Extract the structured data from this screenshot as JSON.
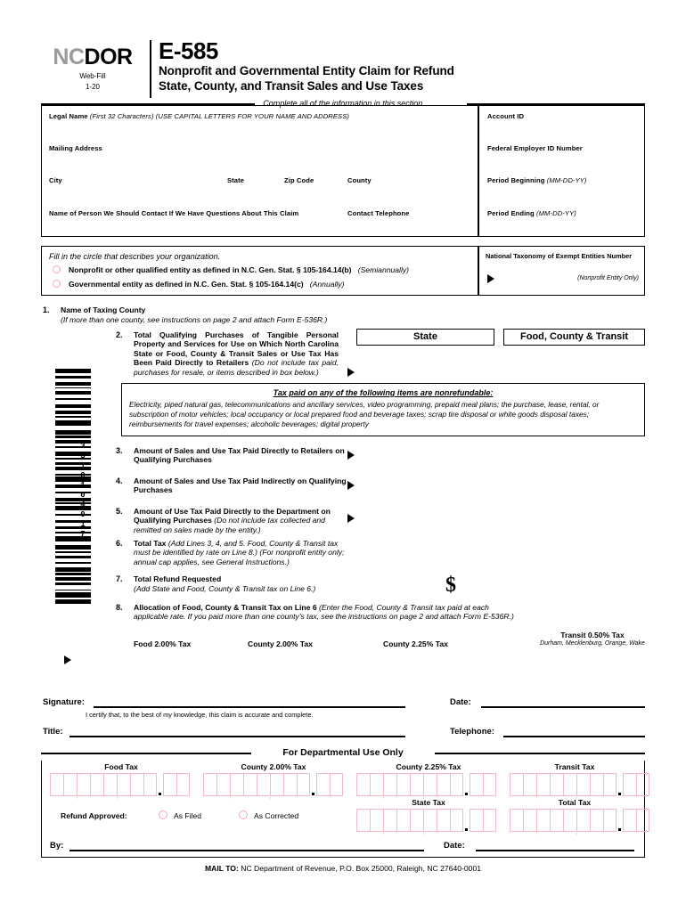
{
  "header": {
    "logo_nc": "NC",
    "logo_dor": "DOR",
    "webfill": "Web-Fill",
    "revision": "1-20",
    "form_number": "E-585",
    "title_line1": "Nonprofit and Governmental Entity Claim for Refund",
    "title_line2": "State, County, and Transit Sales and Use Taxes",
    "complete_note": "Complete all of the information in this section."
  },
  "identification": {
    "legal_name_label": "Legal Name",
    "legal_name_note": "(First 32 Characters) (USE CAPITAL LETTERS FOR YOUR NAME AND ADDRESS)",
    "mailing_address_label": "Mailing Address",
    "city_label": "City",
    "state_label": "State",
    "zip_label": "Zip Code",
    "county_label": "County",
    "contact_name_label": "Name of Person We Should Contact If We Have Questions About This Claim",
    "contact_phone_label": "Contact Telephone",
    "account_id_label": "Account ID",
    "fein_label": "Federal Employer  ID Number",
    "period_beginning_label": "Period Beginning",
    "period_beginning_format": "(MM-DD-YY)",
    "period_ending_label": "Period Ending",
    "period_ending_format": "(MM-DD-YY)"
  },
  "organization": {
    "instruction": "Fill in the circle that describes your organization.",
    "option1_text": "Nonprofit or other qualified entity as defined in N.C. Gen. Stat. § 105-164.14(b)",
    "option1_freq": "(Semiannually)",
    "option2_text": "Governmental entity as defined in N.C. Gen. Stat. § 105-164.14(c)",
    "option2_freq": "(Annually)",
    "ntee_label": "National Taxonomy of Exempt Entities Number",
    "ntee_note": "(Nonprofit Entity Only)"
  },
  "lines": {
    "l1_num": "1.",
    "l1_title": "Name of Taxing County",
    "l1_note": "(If more than one county, see instructions on page 2 and attach Form E-536R.)",
    "l2_num": "2.",
    "l2_text": "Total Qualifying Purchases of Tangible Personal Property and Services for Use on Which North Carolina State or Food, County & Transit Sales or Use Tax Has Been Paid Directly to Retailers",
    "l2_note": "(Do not include tax paid, purchases for resale, or items described in box below.)",
    "col_state": "State",
    "col_fct": "Food, County & Transit",
    "l3_num": "3.",
    "l3_text": "Amount of Sales and Use Tax Paid Directly to Retailers on Qualifying Purchases",
    "l4_num": "4.",
    "l4_text": "Amount of Sales and Use Tax Paid Indirectly on Qualifying Purchases",
    "l5_num": "5.",
    "l5_text": "Amount of Use Tax Paid Directly to the Department on Qualifying Purchases",
    "l5_note": "(Do not include tax collected and remitted on sales made by the entity.)",
    "l6_num": "6.",
    "l6_text": "Total Tax",
    "l6_note": "(Add Lines 3, 4, and 5.  Food, County & Transit tax must be identified by rate on Line 8.)  (For nonprofit entity only; annual cap applies, see General Instructions.)",
    "l7_num": "7.",
    "l7_text": "Total Refund Requested",
    "l7_note": "(Add State and Food, County & Transit tax on Line 6.)",
    "l7_dollar": "$",
    "l8_num": "8.",
    "l8_text": "Allocation of Food, County & Transit Tax on Line 6",
    "l8_note": "(Enter the Food, County & Transit tax paid at each applicable rate. If you paid more than one county's tax, see the instructions on page 2 and attach Form E-536R.)"
  },
  "nonrefundable": {
    "title": "Tax paid on any of the following items are nonrefundable:",
    "body": "Electricity, piped natural gas, telecommunications and ancillary services, video programming, prepaid meal plans;  the purchase, lease, rental, or subscription of motor vehicles; local occupancy or local prepared food and beverage taxes;   scrap  tire  disposal or white goods disposal taxes;   reimbursements for travel expenses;   alcoholic beverages;   digital property"
  },
  "rates": {
    "food": "Food 2.00% Tax",
    "county200": "County 2.00% Tax",
    "county225": "County 2.25% Tax",
    "transit": "Transit 0.50% Tax",
    "transit_counties": "Durham, Mecklenburg, Orange, Wake"
  },
  "barcode": {
    "number": "3310104017"
  },
  "signature": {
    "signature_label": "Signature:",
    "date_label": "Date:",
    "certification": "I certify that, to the best of my knowledge, this claim is accurate and complete.",
    "title_label": "Title:",
    "telephone_label": "Telephone:"
  },
  "departmental": {
    "section_title": "For Departmental Use Only",
    "col_food": "Food Tax",
    "col_county200": "County 2.00% Tax",
    "col_county225": "County 2.25% Tax",
    "col_transit": "Transit Tax",
    "col_state": "State Tax",
    "col_total": "Total Tax",
    "refund_approved_label": "Refund Approved:",
    "opt_as_filed": "As Filed",
    "opt_as_corrected": "As Corrected",
    "by_label": "By:",
    "date_label": "Date:"
  },
  "footer": {
    "mail_to_bold": "MAIL TO:",
    "mail_to_rest": " NC Department of Revenue, P.O. Box 25000, Raleigh, NC 27640-0001"
  },
  "colors": {
    "pink": "#f7b8c3",
    "gray_logo": "#9a9a9a",
    "black": "#000000"
  }
}
